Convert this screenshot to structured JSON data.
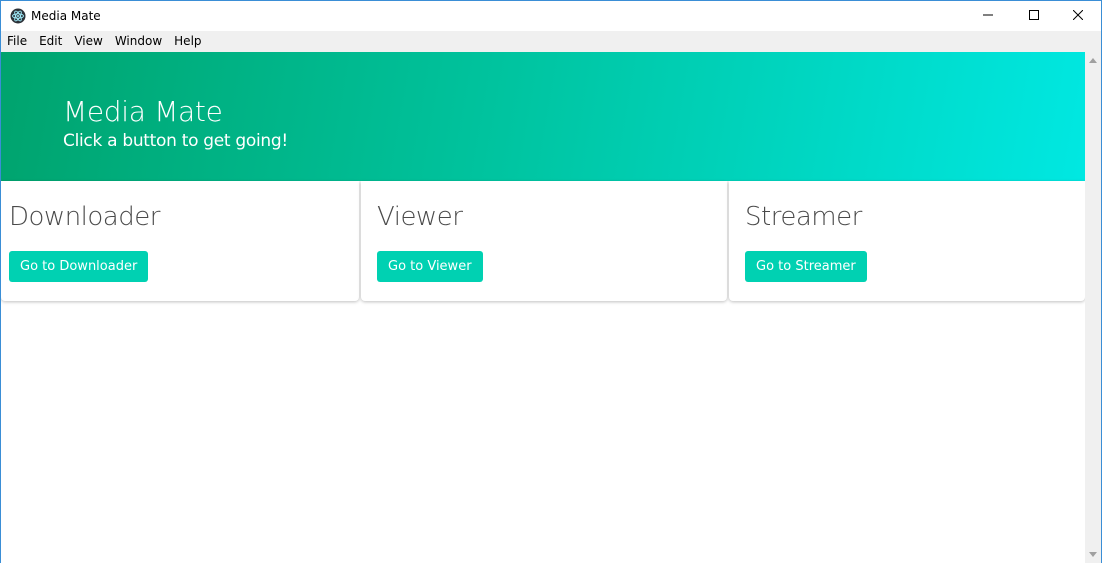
{
  "window": {
    "title": "Media Mate",
    "app_icon": "electron-atom-icon",
    "controls": [
      "minimize-icon",
      "maximize-icon",
      "close-icon"
    ]
  },
  "menubar": {
    "items": [
      "File",
      "Edit",
      "View",
      "Window",
      "Help"
    ]
  },
  "hero": {
    "title": "Media Mate",
    "subtitle": "Click a button to get going!",
    "gradient_colors": [
      "#00a36d",
      "#00c39e",
      "#00e8e2"
    ]
  },
  "cards": [
    {
      "title": "Downloader",
      "button_label": "Go to Downloader"
    },
    {
      "title": "Viewer",
      "button_label": "Go to Viewer"
    },
    {
      "title": "Streamer",
      "button_label": "Go to Streamer"
    }
  ],
  "colors": {
    "accent_button": "#00d1b2",
    "window_border": "#3a8ed6"
  }
}
